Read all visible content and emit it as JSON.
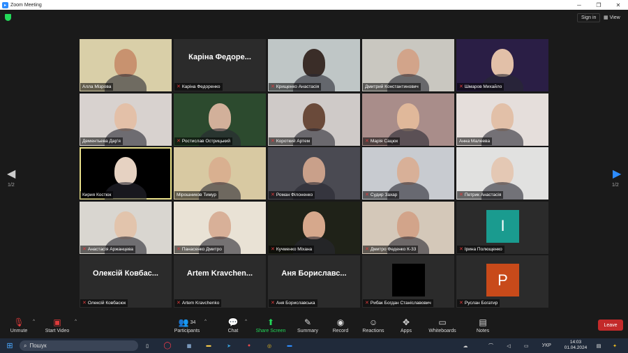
{
  "window": {
    "title": "Zoom Meeting",
    "minimize": "─",
    "maximize": "❐",
    "close": "✕"
  },
  "topbar": {
    "sign_in": "Sign in",
    "view": "View"
  },
  "pager": {
    "left": "1/2",
    "right": "1/2"
  },
  "participants": [
    {
      "name": "Алла Мізрова",
      "muted": false,
      "video": true,
      "bg": "#d9cfa8",
      "face": "#c8926f"
    },
    {
      "name": "Каріна Федоренко",
      "muted": true,
      "video": false,
      "display": "Каріна Федоре..."
    },
    {
      "name": "Крищенко Анастасія",
      "muted": true,
      "video": true,
      "bg": "#bfc6c6",
      "face": "#3a2d28"
    },
    {
      "name": "Дмитрий Константинович",
      "muted": false,
      "video": true,
      "bg": "#c9c7c0",
      "face": "#d2a48a"
    },
    {
      "name": "Шмаров Михайло",
      "muted": true,
      "video": true,
      "bg": "#2a1e45",
      "face": "#e2c0a8"
    },
    {
      "name": "Дементьева Дар'я",
      "muted": false,
      "video": true,
      "bg": "#d8d2cf",
      "face": "#e3c0a8"
    },
    {
      "name": "Ростислав Острицький",
      "muted": true,
      "video": true,
      "bg": "#2c4a2e",
      "face": "#d2b09a"
    },
    {
      "name": "Короткий Артем",
      "muted": true,
      "video": true,
      "bg": "#cfcac8",
      "face": "#6a4a3a"
    },
    {
      "name": "Марія Сацюк",
      "muted": true,
      "video": true,
      "bg": "#a98d8a",
      "face": "#e0b89a"
    },
    {
      "name": "Анна Малеева",
      "muted": false,
      "video": true,
      "bg": "#e5dedb",
      "face": "#e2c0a8"
    },
    {
      "name": "Кирия Костюк",
      "muted": false,
      "video": true,
      "bg": "#000000",
      "face": "#e6d2c2",
      "active": true
    },
    {
      "name": "Мірошников Тимур",
      "muted": false,
      "video": true,
      "bg": "#d8c9a2",
      "face": "#d9b090"
    },
    {
      "name": "Роман Філоненко",
      "muted": true,
      "video": true,
      "bg": "#4a4a52",
      "face": "#c9a08a"
    },
    {
      "name": "Судир Захар",
      "muted": true,
      "video": true,
      "bg": "#c8cbd0",
      "face": "#d8b098"
    },
    {
      "name": "Петрик Анастасія",
      "muted": true,
      "video": true,
      "bg": "#e1e1e0",
      "face": "#e4c8b4"
    },
    {
      "name": "Анастасія Аржанцева",
      "muted": true,
      "video": true,
      "bg": "#d9d6d0",
      "face": "#e2c4ac"
    },
    {
      "name": "Панасенко Дмитро",
      "muted": true,
      "video": true,
      "bg": "#e9e2d5",
      "face": "#d8b098"
    },
    {
      "name": "Кучменко Міхана",
      "muted": true,
      "video": true,
      "bg": "#1f2218",
      "face": "#d6a88c"
    },
    {
      "name": "Дмитро Феденко К-33",
      "muted": true,
      "video": true,
      "bg": "#d4c8b9",
      "face": "#d2a48a"
    },
    {
      "name": "Ірина Полющенко",
      "muted": true,
      "video": false,
      "avatar_letter": "I",
      "avatar_color": "#1a9b8f"
    },
    {
      "name": "Олексій Ковбасюк",
      "muted": true,
      "video": false,
      "display": "Олексій Ковбас..."
    },
    {
      "name": "Artem Kravchenko",
      "muted": true,
      "video": false,
      "display": "Artem Kravchen..."
    },
    {
      "name": "Аня Бориславська",
      "muted": true,
      "video": false,
      "display": "Аня Бориславс..."
    },
    {
      "name": "Рибак Богдан Станіславович",
      "muted": true,
      "video": false,
      "black": true
    },
    {
      "name": "Руслан Богатир",
      "muted": true,
      "video": false,
      "avatar_letter": "P",
      "avatar_color": "#c84a1a"
    }
  ],
  "toolbar": {
    "unmute": "Unmute",
    "start_video": "Start Video",
    "participants": "Participants",
    "participants_count": "34",
    "chat": "Chat",
    "share_screen": "Share Screen",
    "summary": "Summary",
    "record": "Record",
    "reactions": "Reactions",
    "apps": "Apps",
    "whiteboards": "Whiteboards",
    "notes": "Notes",
    "leave": "Leave"
  },
  "taskbar": {
    "search": "Пошук",
    "lang": "УКР",
    "time": "14:03",
    "date": "01.04.2024"
  }
}
